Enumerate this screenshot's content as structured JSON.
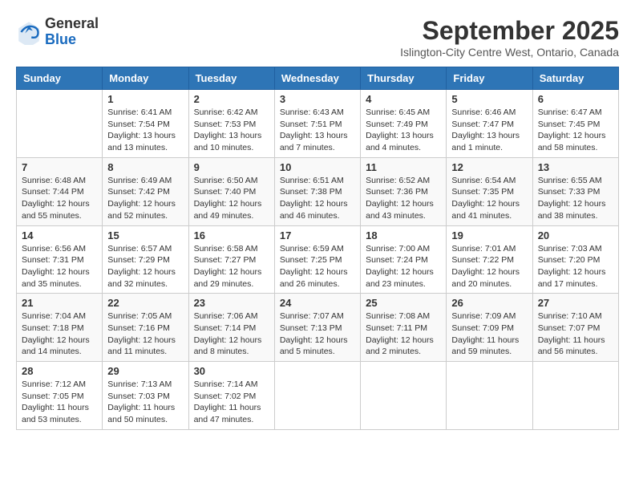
{
  "header": {
    "logo_general": "General",
    "logo_blue": "Blue",
    "month_title": "September 2025",
    "subtitle": "Islington-City Centre West, Ontario, Canada"
  },
  "days_of_week": [
    "Sunday",
    "Monday",
    "Tuesday",
    "Wednesday",
    "Thursday",
    "Friday",
    "Saturday"
  ],
  "weeks": [
    [
      {
        "day": "",
        "info": ""
      },
      {
        "day": "1",
        "info": "Sunrise: 6:41 AM\nSunset: 7:54 PM\nDaylight: 13 hours\nand 13 minutes."
      },
      {
        "day": "2",
        "info": "Sunrise: 6:42 AM\nSunset: 7:53 PM\nDaylight: 13 hours\nand 10 minutes."
      },
      {
        "day": "3",
        "info": "Sunrise: 6:43 AM\nSunset: 7:51 PM\nDaylight: 13 hours\nand 7 minutes."
      },
      {
        "day": "4",
        "info": "Sunrise: 6:45 AM\nSunset: 7:49 PM\nDaylight: 13 hours\nand 4 minutes."
      },
      {
        "day": "5",
        "info": "Sunrise: 6:46 AM\nSunset: 7:47 PM\nDaylight: 13 hours\nand 1 minute."
      },
      {
        "day": "6",
        "info": "Sunrise: 6:47 AM\nSunset: 7:45 PM\nDaylight: 12 hours\nand 58 minutes."
      }
    ],
    [
      {
        "day": "7",
        "info": "Sunrise: 6:48 AM\nSunset: 7:44 PM\nDaylight: 12 hours\nand 55 minutes."
      },
      {
        "day": "8",
        "info": "Sunrise: 6:49 AM\nSunset: 7:42 PM\nDaylight: 12 hours\nand 52 minutes."
      },
      {
        "day": "9",
        "info": "Sunrise: 6:50 AM\nSunset: 7:40 PM\nDaylight: 12 hours\nand 49 minutes."
      },
      {
        "day": "10",
        "info": "Sunrise: 6:51 AM\nSunset: 7:38 PM\nDaylight: 12 hours\nand 46 minutes."
      },
      {
        "day": "11",
        "info": "Sunrise: 6:52 AM\nSunset: 7:36 PM\nDaylight: 12 hours\nand 43 minutes."
      },
      {
        "day": "12",
        "info": "Sunrise: 6:54 AM\nSunset: 7:35 PM\nDaylight: 12 hours\nand 41 minutes."
      },
      {
        "day": "13",
        "info": "Sunrise: 6:55 AM\nSunset: 7:33 PM\nDaylight: 12 hours\nand 38 minutes."
      }
    ],
    [
      {
        "day": "14",
        "info": "Sunrise: 6:56 AM\nSunset: 7:31 PM\nDaylight: 12 hours\nand 35 minutes."
      },
      {
        "day": "15",
        "info": "Sunrise: 6:57 AM\nSunset: 7:29 PM\nDaylight: 12 hours\nand 32 minutes."
      },
      {
        "day": "16",
        "info": "Sunrise: 6:58 AM\nSunset: 7:27 PM\nDaylight: 12 hours\nand 29 minutes."
      },
      {
        "day": "17",
        "info": "Sunrise: 6:59 AM\nSunset: 7:25 PM\nDaylight: 12 hours\nand 26 minutes."
      },
      {
        "day": "18",
        "info": "Sunrise: 7:00 AM\nSunset: 7:24 PM\nDaylight: 12 hours\nand 23 minutes."
      },
      {
        "day": "19",
        "info": "Sunrise: 7:01 AM\nSunset: 7:22 PM\nDaylight: 12 hours\nand 20 minutes."
      },
      {
        "day": "20",
        "info": "Sunrise: 7:03 AM\nSunset: 7:20 PM\nDaylight: 12 hours\nand 17 minutes."
      }
    ],
    [
      {
        "day": "21",
        "info": "Sunrise: 7:04 AM\nSunset: 7:18 PM\nDaylight: 12 hours\nand 14 minutes."
      },
      {
        "day": "22",
        "info": "Sunrise: 7:05 AM\nSunset: 7:16 PM\nDaylight: 12 hours\nand 11 minutes."
      },
      {
        "day": "23",
        "info": "Sunrise: 7:06 AM\nSunset: 7:14 PM\nDaylight: 12 hours\nand 8 minutes."
      },
      {
        "day": "24",
        "info": "Sunrise: 7:07 AM\nSunset: 7:13 PM\nDaylight: 12 hours\nand 5 minutes."
      },
      {
        "day": "25",
        "info": "Sunrise: 7:08 AM\nSunset: 7:11 PM\nDaylight: 12 hours\nand 2 minutes."
      },
      {
        "day": "26",
        "info": "Sunrise: 7:09 AM\nSunset: 7:09 PM\nDaylight: 11 hours\nand 59 minutes."
      },
      {
        "day": "27",
        "info": "Sunrise: 7:10 AM\nSunset: 7:07 PM\nDaylight: 11 hours\nand 56 minutes."
      }
    ],
    [
      {
        "day": "28",
        "info": "Sunrise: 7:12 AM\nSunset: 7:05 PM\nDaylight: 11 hours\nand 53 minutes."
      },
      {
        "day": "29",
        "info": "Sunrise: 7:13 AM\nSunset: 7:03 PM\nDaylight: 11 hours\nand 50 minutes."
      },
      {
        "day": "30",
        "info": "Sunrise: 7:14 AM\nSunset: 7:02 PM\nDaylight: 11 hours\nand 47 minutes."
      },
      {
        "day": "",
        "info": ""
      },
      {
        "day": "",
        "info": ""
      },
      {
        "day": "",
        "info": ""
      },
      {
        "day": "",
        "info": ""
      }
    ]
  ]
}
